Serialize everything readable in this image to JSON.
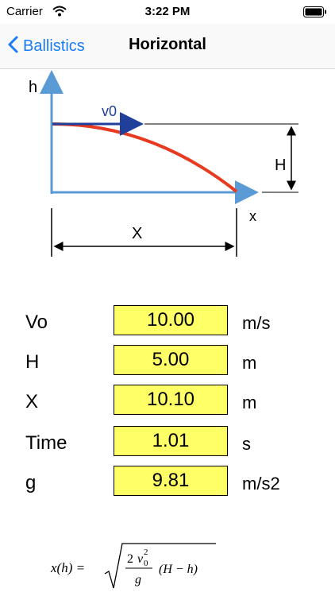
{
  "status_bar": {
    "carrier": "Carrier",
    "time": "3:22 PM"
  },
  "nav": {
    "back_label": "Ballistics",
    "title": "Horizontal"
  },
  "diagram": {
    "axis_h": "h",
    "axis_x": "x",
    "v0_label": "v0",
    "height_label": "H",
    "distance_label": "X"
  },
  "fields": [
    {
      "label": "Vo",
      "value": "10.00",
      "unit": "m/s"
    },
    {
      "label": "H",
      "value": "5.00",
      "unit": "m"
    },
    {
      "label": "X",
      "value": "10.10",
      "unit": "m"
    },
    {
      "label": "Time",
      "value": "1.01",
      "unit": "s"
    },
    {
      "label": "g",
      "value": "9.81",
      "unit": "m/s2"
    }
  ],
  "formula": {
    "lhs": "x(h) =",
    "num_coef": "2",
    "num_var": "v",
    "num_sub": "0",
    "num_sup": "2",
    "denom": "g",
    "rhs": "(H − h)"
  },
  "colors": {
    "accent": "#1a7cf5",
    "field_bg": "#ffff66",
    "trajectory": "#e83a20",
    "axis": "#5b9bd5"
  }
}
